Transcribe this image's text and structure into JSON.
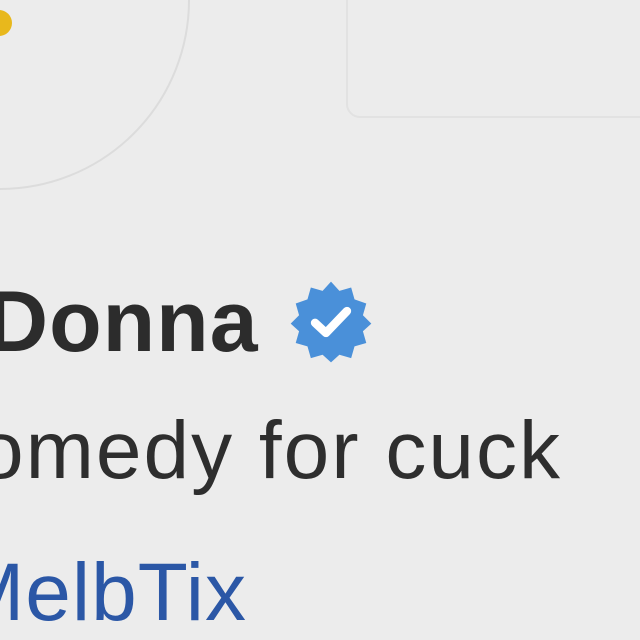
{
  "profile": {
    "display_name": "Donna",
    "verified_icon": "verified-badge-icon",
    "bio": "omedy for cuck",
    "link_text": "MelbTix"
  },
  "colors": {
    "background": "#ececec",
    "text": "#2c2c2c",
    "link": "#2b57a6",
    "verified": "#4a90d9",
    "avatar_accent": "#e8b81c"
  }
}
